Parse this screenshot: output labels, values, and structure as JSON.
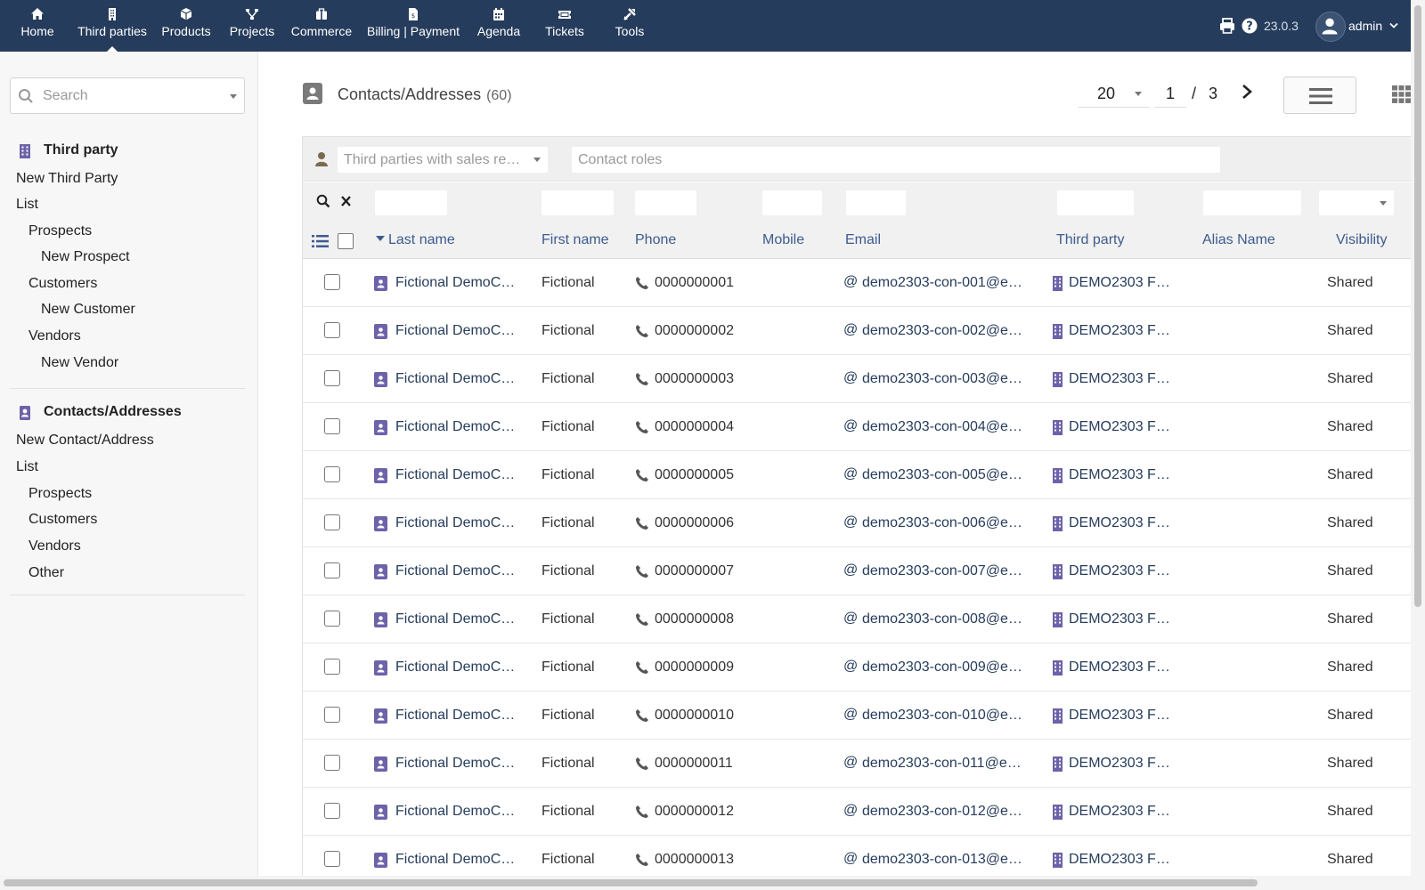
{
  "topnav": {
    "items": [
      {
        "label": "Home",
        "icon": "home-icon"
      },
      {
        "label": "Third parties",
        "icon": "building-icon"
      },
      {
        "label": "Products",
        "icon": "cube-icon"
      },
      {
        "label": "Projects",
        "icon": "sitemap-icon"
      },
      {
        "label": "Commerce",
        "icon": "suitcase-icon"
      },
      {
        "label": "Billing | Payment",
        "icon": "invoice-icon"
      },
      {
        "label": "Agenda",
        "icon": "calendar-icon"
      },
      {
        "label": "Tickets",
        "icon": "ticket-icon"
      },
      {
        "label": "Tools",
        "icon": "tools-icon"
      }
    ],
    "active": "Third parties",
    "version": "23.0.3",
    "user": "admin"
  },
  "sidebar": {
    "search_placeholder": "Search",
    "section1": {
      "title": "Third party",
      "links": [
        "New Third Party",
        "List",
        "Prospects",
        "New Prospect",
        "Customers",
        "New Customer",
        "Vendors",
        "New Vendor"
      ]
    },
    "section2": {
      "title": "Contacts/Addresses",
      "links": [
        "New Contact/Address",
        "List",
        "Prospects",
        "Customers",
        "Vendors",
        "Other"
      ]
    }
  },
  "main": {
    "title": "Contacts/Addresses",
    "count": "(60)",
    "limit": "20",
    "page_current": "1",
    "page_sep": "/",
    "page_total": "3",
    "filter_sales_placeholder": "Third parties with sales re…",
    "filter_roles_placeholder": "Contact roles",
    "columns": {
      "lastname": "Last name",
      "firstname": "First name",
      "phone": "Phone",
      "mobile": "Mobile",
      "email": "Email",
      "thirdparty": "Third party",
      "alias": "Alias Name",
      "visibility": "Visibility"
    },
    "rows": [
      {
        "lastname": "Fictional DemoC…",
        "firstname": "Fictional",
        "phone": "0000000001",
        "email": "demo2303-con-001@e…",
        "thirdparty": "DEMO2303 F…",
        "visibility": "Shared"
      },
      {
        "lastname": "Fictional DemoC…",
        "firstname": "Fictional",
        "phone": "0000000002",
        "email": "demo2303-con-002@e…",
        "thirdparty": "DEMO2303 F…",
        "visibility": "Shared"
      },
      {
        "lastname": "Fictional DemoC…",
        "firstname": "Fictional",
        "phone": "0000000003",
        "email": "demo2303-con-003@e…",
        "thirdparty": "DEMO2303 F…",
        "visibility": "Shared"
      },
      {
        "lastname": "Fictional DemoC…",
        "firstname": "Fictional",
        "phone": "0000000004",
        "email": "demo2303-con-004@e…",
        "thirdparty": "DEMO2303 F…",
        "visibility": "Shared"
      },
      {
        "lastname": "Fictional DemoC…",
        "firstname": "Fictional",
        "phone": "0000000005",
        "email": "demo2303-con-005@e…",
        "thirdparty": "DEMO2303 F…",
        "visibility": "Shared"
      },
      {
        "lastname": "Fictional DemoC…",
        "firstname": "Fictional",
        "phone": "0000000006",
        "email": "demo2303-con-006@e…",
        "thirdparty": "DEMO2303 F…",
        "visibility": "Shared"
      },
      {
        "lastname": "Fictional DemoC…",
        "firstname": "Fictional",
        "phone": "0000000007",
        "email": "demo2303-con-007@e…",
        "thirdparty": "DEMO2303 F…",
        "visibility": "Shared"
      },
      {
        "lastname": "Fictional DemoC…",
        "firstname": "Fictional",
        "phone": "0000000008",
        "email": "demo2303-con-008@e…",
        "thirdparty": "DEMO2303 F…",
        "visibility": "Shared"
      },
      {
        "lastname": "Fictional DemoC…",
        "firstname": "Fictional",
        "phone": "0000000009",
        "email": "demo2303-con-009@e…",
        "thirdparty": "DEMO2303 F…",
        "visibility": "Shared"
      },
      {
        "lastname": "Fictional DemoC…",
        "firstname": "Fictional",
        "phone": "0000000010",
        "email": "demo2303-con-010@e…",
        "thirdparty": "DEMO2303 F…",
        "visibility": "Shared"
      },
      {
        "lastname": "Fictional DemoC…",
        "firstname": "Fictional",
        "phone": "0000000011",
        "email": "demo2303-con-011@e…",
        "thirdparty": "DEMO2303 F…",
        "visibility": "Shared"
      },
      {
        "lastname": "Fictional DemoC…",
        "firstname": "Fictional",
        "phone": "0000000012",
        "email": "demo2303-con-012@e…",
        "thirdparty": "DEMO2303 F…",
        "visibility": "Shared"
      },
      {
        "lastname": "Fictional DemoC…",
        "firstname": "Fictional",
        "phone": "0000000013",
        "email": "demo2303-con-013@e…",
        "thirdparty": "DEMO2303 F…",
        "visibility": "Shared"
      }
    ]
  },
  "colors": {
    "topbar": "#263c5c",
    "link": "#263c5c",
    "header_link": "#3d5b8e",
    "accent": "#6c63a8"
  }
}
